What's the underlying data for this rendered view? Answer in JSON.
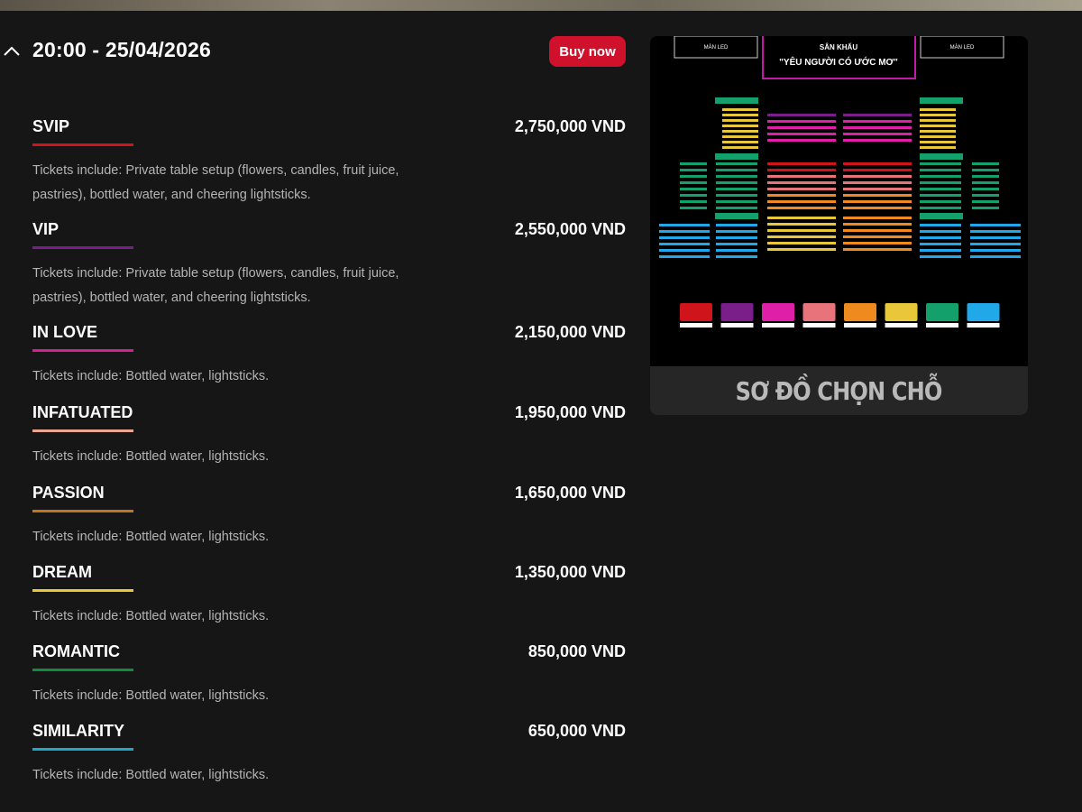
{
  "session": {
    "datetime": "20:00 - 25/04/2026",
    "buy_label": "Buy now"
  },
  "tickets": [
    {
      "name": "SVIP",
      "price": "2,750,000 VND",
      "color": "#d0141c",
      "desc": "Tickets include: Private table setup (flowers, candles, fruit juice, pastries), bottled water, and cheering lightsticks."
    },
    {
      "name": "VIP",
      "price": "2,550,000 VND",
      "color": "#7a1f8a",
      "desc": "Tickets include: Private table setup (flowers, candles, fruit juice, pastries), bottled water, and cheering lightsticks."
    },
    {
      "name": "IN LOVE",
      "price": "2,150,000 VND",
      "color": "#d1238e",
      "desc": "Tickets include: Bottled water, lightsticks."
    },
    {
      "name": "INFATUATED",
      "price": "1,950,000 VND",
      "color": "#e8a58f",
      "desc": "Tickets include: Bottled water, lightsticks."
    },
    {
      "name": "PASSION",
      "price": "1,650,000 VND",
      "color": "#c3741c",
      "desc": "Tickets include: Bottled water, lightsticks."
    },
    {
      "name": "DREAM",
      "price": "1,350,000 VND",
      "color": "#e8c83a",
      "desc": "Tickets include: Bottled water, lightsticks."
    },
    {
      "name": "ROMANTIC",
      "price": "850,000 VND",
      "color": "#138a3e",
      "desc": "Tickets include: Bottled water, lightsticks."
    },
    {
      "name": "SIMILARITY",
      "price": "650,000 VND",
      "color": "#21a8c8",
      "desc": "Tickets include: Bottled water, lightsticks."
    }
  ],
  "seat_map": {
    "stage_label": "SÂN KHẤU",
    "stage_subtitle": "\"YÊU NGƯỜI CÓ ƯỚC MƠ\"",
    "screen_label": "MÀN LED",
    "title": "SƠ ĐỒ CHỌN CHỖ",
    "zone_colors": [
      "#d0141c",
      "#7a1f8a",
      "#e01fa8",
      "#e8737a",
      "#ef8a1f",
      "#e8c83a",
      "#13a06a",
      "#21a8e8"
    ]
  }
}
